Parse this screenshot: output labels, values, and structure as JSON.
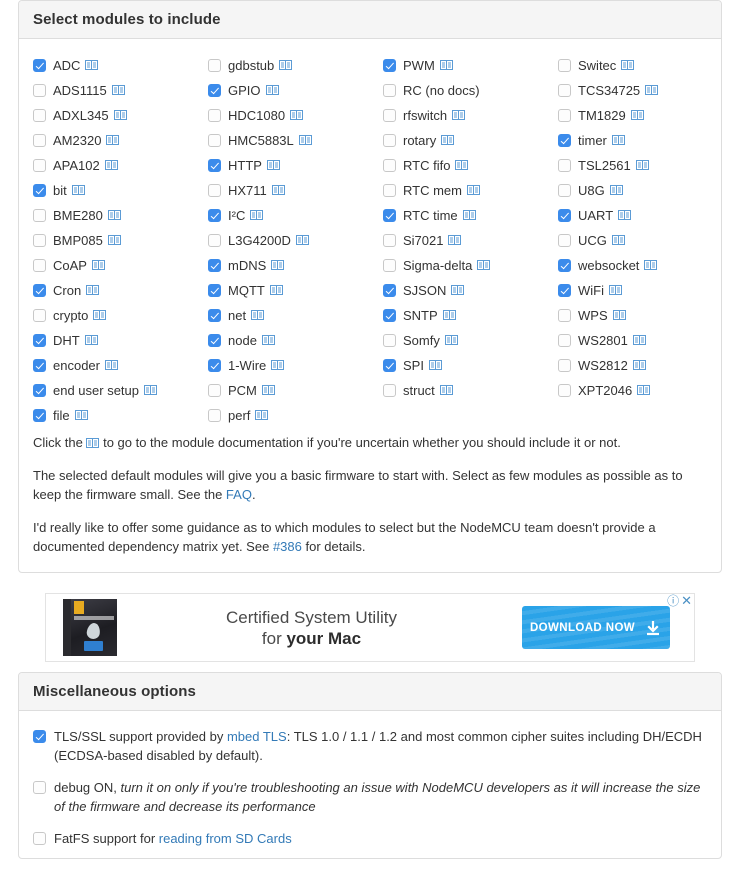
{
  "modules_panel": {
    "title": "Select modules to include",
    "doc_icon_name": "book-docs-icon",
    "columns": [
      [
        {
          "label": "ADC",
          "checked": true,
          "has_doc": true
        },
        {
          "label": "ADS1115",
          "checked": false,
          "has_doc": true
        },
        {
          "label": "ADXL345",
          "checked": false,
          "has_doc": true
        },
        {
          "label": "AM2320",
          "checked": false,
          "has_doc": true
        },
        {
          "label": "APA102",
          "checked": false,
          "has_doc": true
        },
        {
          "label": "bit",
          "checked": true,
          "has_doc": true
        },
        {
          "label": "BME280",
          "checked": false,
          "has_doc": true
        },
        {
          "label": "BMP085",
          "checked": false,
          "has_doc": true
        },
        {
          "label": "CoAP",
          "checked": false,
          "has_doc": true
        },
        {
          "label": "Cron",
          "checked": true,
          "has_doc": true
        },
        {
          "label": "crypto",
          "checked": false,
          "has_doc": true
        },
        {
          "label": "DHT",
          "checked": true,
          "has_doc": true
        },
        {
          "label": "encoder",
          "checked": true,
          "has_doc": true
        },
        {
          "label": "end user setup",
          "checked": true,
          "has_doc": true
        },
        {
          "label": "file",
          "checked": true,
          "has_doc": true
        }
      ],
      [
        {
          "label": "gdbstub",
          "checked": false,
          "has_doc": true
        },
        {
          "label": "GPIO",
          "checked": true,
          "has_doc": true
        },
        {
          "label": "HDC1080",
          "checked": false,
          "has_doc": true
        },
        {
          "label": "HMC5883L",
          "checked": false,
          "has_doc": true
        },
        {
          "label": "HTTP",
          "checked": true,
          "has_doc": true
        },
        {
          "label": "HX711",
          "checked": false,
          "has_doc": true
        },
        {
          "label": "I²C",
          "checked": true,
          "has_doc": true
        },
        {
          "label": "L3G4200D",
          "checked": false,
          "has_doc": true
        },
        {
          "label": "mDNS",
          "checked": true,
          "has_doc": true
        },
        {
          "label": "MQTT",
          "checked": true,
          "has_doc": true
        },
        {
          "label": "net",
          "checked": true,
          "has_doc": true
        },
        {
          "label": "node",
          "checked": true,
          "has_doc": true
        },
        {
          "label": "1-Wire",
          "checked": true,
          "has_doc": true
        },
        {
          "label": "PCM",
          "checked": false,
          "has_doc": true
        },
        {
          "label": "perf",
          "checked": false,
          "has_doc": true
        }
      ],
      [
        {
          "label": "PWM",
          "checked": true,
          "has_doc": true
        },
        {
          "label": "RC (no docs)",
          "checked": false,
          "has_doc": false
        },
        {
          "label": "rfswitch",
          "checked": false,
          "has_doc": true
        },
        {
          "label": "rotary",
          "checked": false,
          "has_doc": true
        },
        {
          "label": "RTC fifo",
          "checked": false,
          "has_doc": true
        },
        {
          "label": "RTC mem",
          "checked": false,
          "has_doc": true
        },
        {
          "label": "RTC time",
          "checked": true,
          "has_doc": true
        },
        {
          "label": "Si7021",
          "checked": false,
          "has_doc": true
        },
        {
          "label": "Sigma-delta",
          "checked": false,
          "has_doc": true
        },
        {
          "label": "SJSON",
          "checked": true,
          "has_doc": true
        },
        {
          "label": "SNTP",
          "checked": true,
          "has_doc": true
        },
        {
          "label": "Somfy",
          "checked": false,
          "has_doc": true
        },
        {
          "label": "SPI",
          "checked": true,
          "has_doc": true
        },
        {
          "label": "struct",
          "checked": false,
          "has_doc": true
        }
      ],
      [
        {
          "label": "Switec",
          "checked": false,
          "has_doc": true
        },
        {
          "label": "TCS34725",
          "checked": false,
          "has_doc": true
        },
        {
          "label": "TM1829",
          "checked": false,
          "has_doc": true
        },
        {
          "label": "timer",
          "checked": true,
          "has_doc": true
        },
        {
          "label": "TSL2561",
          "checked": false,
          "has_doc": true
        },
        {
          "label": "U8G",
          "checked": false,
          "has_doc": true
        },
        {
          "label": "UART",
          "checked": true,
          "has_doc": true
        },
        {
          "label": "UCG",
          "checked": false,
          "has_doc": true
        },
        {
          "label": "websocket",
          "checked": true,
          "has_doc": true
        },
        {
          "label": "WiFi",
          "checked": true,
          "has_doc": true
        },
        {
          "label": "WPS",
          "checked": false,
          "has_doc": true
        },
        {
          "label": "WS2801",
          "checked": false,
          "has_doc": true
        },
        {
          "label": "WS2812",
          "checked": false,
          "has_doc": true
        },
        {
          "label": "XPT2046",
          "checked": false,
          "has_doc": true
        }
      ]
    ],
    "paragraphs": {
      "p1_before": "Click the ",
      "p1_after": " to go to the module documentation if you're uncertain whether you should include it or not.",
      "p2_before": "The selected default modules will give you a basic firmware to start with. Select as few modules as possible as to keep the firmware small. See the ",
      "p2_link": "FAQ",
      "p2_after": ".",
      "p3_before": "I'd really like to offer some guidance as to which modules to select but the NodeMCU team doesn't provide a documented dependency matrix yet. See ",
      "p3_link": "#386",
      "p3_after": " for details."
    }
  },
  "ad": {
    "line1": "Certified System Utility",
    "line2_plain": "for ",
    "line2_bold": "your Mac",
    "button_label": "DOWNLOAD NOW",
    "adchoices_glyph": "ⓘ",
    "close_glyph": "✕",
    "button_color": "#2aa3e8"
  },
  "misc_panel": {
    "title": "Miscellaneous options",
    "options": [
      {
        "name": "tls-ssl",
        "checked": true,
        "before": "TLS/SSL support provided by ",
        "link": "mbed TLS",
        "after": ": TLS 1.0 / 1.1 / 1.2 and most common cipher suites including DH/ECDH (ECDSA-based disabled by default).",
        "italic": ""
      },
      {
        "name": "debug-on",
        "checked": false,
        "before": "debug ON, ",
        "link": "",
        "after": "",
        "italic": "turn it on only if you're troubleshooting an issue with NodeMCU developers as it will increase the size of the firmware and decrease its performance"
      },
      {
        "name": "fatfs",
        "checked": false,
        "before": "FatFS support for ",
        "link": "reading from SD Cards",
        "after": "",
        "italic": ""
      }
    ]
  },
  "colors": {
    "checkbox_checked": "#3b8beb",
    "link": "#337ab7",
    "panel_border": "#dddddd",
    "panel_heading_bg": "#f5f5f5"
  }
}
